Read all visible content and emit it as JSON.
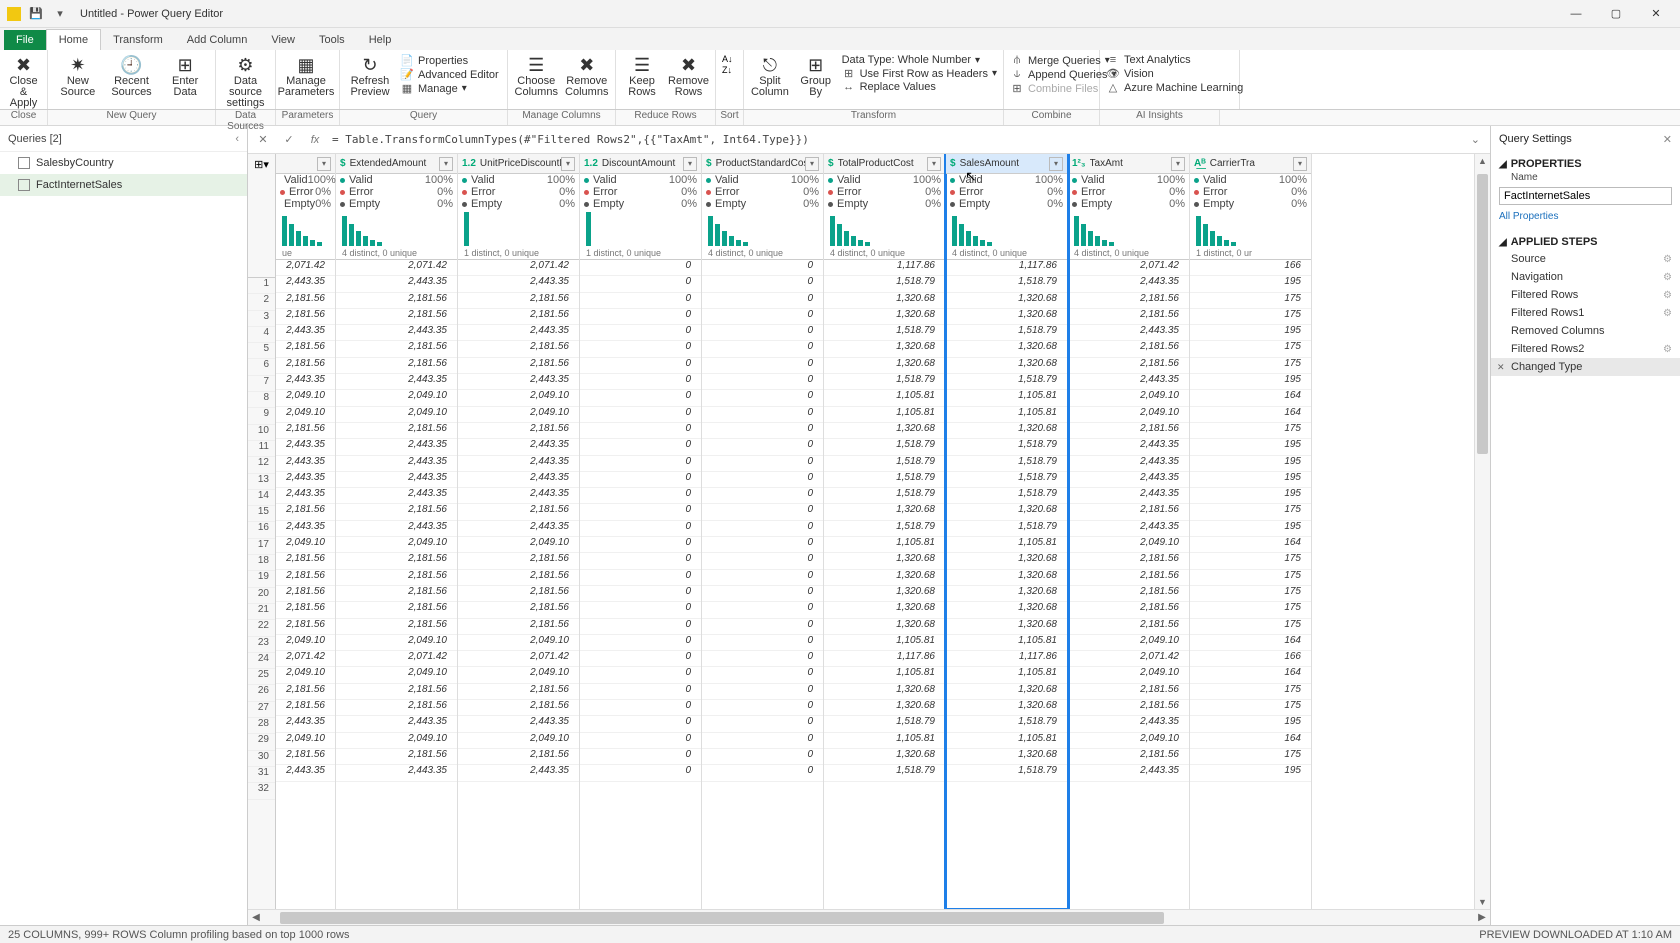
{
  "title": "Untitled - Power Query Editor",
  "menu_tabs": [
    "File",
    "Home",
    "Transform",
    "Add Column",
    "View",
    "Tools",
    "Help"
  ],
  "ribbon": {
    "close_apply": "Close & Apply",
    "new_source": "New Source",
    "recent_sources": "Recent Sources",
    "enter_data": "Enter Data",
    "data_source": "Data source settings",
    "manage_params": "Manage Parameters",
    "refresh": "Refresh Preview",
    "properties": "Properties",
    "adv_editor": "Advanced Editor",
    "manage": "Manage",
    "choose_cols": "Choose Columns",
    "remove_cols": "Remove Columns",
    "keep_rows": "Keep Rows",
    "remove_rows": "Remove Rows",
    "sort": "Sort",
    "split_col": "Split Column",
    "group_by": "Group By",
    "data_type": "Data Type: Whole Number",
    "first_row": "Use First Row as Headers",
    "replace": "Replace Values",
    "merge": "Merge Queries",
    "append": "Append Queries",
    "combine_files": "Combine Files",
    "text_an": "Text Analytics",
    "vision": "Vision",
    "azure_ml": "Azure Machine Learning"
  },
  "ribbon_labels": [
    "Close",
    "New Query",
    "Data Sources",
    "Parameters",
    "Query",
    "Manage Columns",
    "Reduce Rows",
    "Sort",
    "Transform",
    "Combine",
    "AI Insights"
  ],
  "ribbon_widths": [
    48,
    168,
    60,
    64,
    168,
    108,
    100,
    28,
    260,
    96,
    120
  ],
  "queries_header": "Queries [2]",
  "queries": [
    "SalesbyCountry",
    "FactInternetSales"
  ],
  "formula": "= Table.TransformColumnTypes(#\"Filtered Rows2\",{{\"TaxAmt\", Int64.Type}})",
  "columns": [
    {
      "name": "",
      "type": "",
      "first": true,
      "distinct": "ue"
    },
    {
      "name": "ExtendedAmount",
      "type": "$",
      "distinct": "4 distinct, 0 unique"
    },
    {
      "name": "UnitPriceDiscountPct",
      "type": "1.2",
      "distinct": "1 distinct, 0 unique"
    },
    {
      "name": "DiscountAmount",
      "type": "1.2",
      "distinct": "1 distinct, 0 unique"
    },
    {
      "name": "ProductStandardCost",
      "type": "$",
      "distinct": "4 distinct, 0 unique"
    },
    {
      "name": "TotalProductCost",
      "type": "$",
      "distinct": "4 distinct, 0 unique"
    },
    {
      "name": "SalesAmount",
      "type": "$",
      "distinct": "4 distinct, 0 unique",
      "hl": true
    },
    {
      "name": "TaxAmt",
      "type": "1²₃",
      "distinct": "4 distinct, 0 unique"
    },
    {
      "name": "CarrierTra",
      "type": "A͟ᴮ",
      "distinct": "1 distinct, 0 ur"
    }
  ],
  "quality": [
    "Valid",
    "Error",
    "Empty"
  ],
  "quality_pct": [
    "100%",
    "0%",
    "0%"
  ],
  "settings": {
    "title": "Query Settings",
    "props": "PROPERTIES",
    "name_lbl": "Name",
    "name_val": "FactInternetSales",
    "all_props": "All Properties",
    "steps_title": "APPLIED STEPS",
    "steps": [
      "Source",
      "Navigation",
      "Filtered Rows",
      "Filtered Rows1",
      "Removed Columns",
      "Filtered Rows2",
      "Changed Type"
    ]
  },
  "status_left": "25 COLUMNS, 999+ ROWS    Column profiling based on top 1000 rows",
  "status_right": "PREVIEW DOWNLOADED AT 1:10 AM",
  "chart_data": {
    "type": "table",
    "rows": [
      [
        "2,071.42",
        "2,071.42",
        "0",
        "0",
        "1,117.86",
        "1,117.86",
        "2,071.42",
        "166"
      ],
      [
        "2,443.35",
        "2,443.35",
        "0",
        "0",
        "1,518.79",
        "1,518.79",
        "2,443.35",
        "195"
      ],
      [
        "2,181.56",
        "2,181.56",
        "0",
        "0",
        "1,320.68",
        "1,320.68",
        "2,181.56",
        "175"
      ],
      [
        "2,181.56",
        "2,181.56",
        "0",
        "0",
        "1,320.68",
        "1,320.68",
        "2,181.56",
        "175"
      ],
      [
        "2,443.35",
        "2,443.35",
        "0",
        "0",
        "1,518.79",
        "1,518.79",
        "2,443.35",
        "195"
      ],
      [
        "2,181.56",
        "2,181.56",
        "0",
        "0",
        "1,320.68",
        "1,320.68",
        "2,181.56",
        "175"
      ],
      [
        "2,181.56",
        "2,181.56",
        "0",
        "0",
        "1,320.68",
        "1,320.68",
        "2,181.56",
        "175"
      ],
      [
        "2,443.35",
        "2,443.35",
        "0",
        "0",
        "1,518.79",
        "1,518.79",
        "2,443.35",
        "195"
      ],
      [
        "2,049.10",
        "2,049.10",
        "0",
        "0",
        "1,105.81",
        "1,105.81",
        "2,049.10",
        "164"
      ],
      [
        "2,049.10",
        "2,049.10",
        "0",
        "0",
        "1,105.81",
        "1,105.81",
        "2,049.10",
        "164"
      ],
      [
        "2,181.56",
        "2,181.56",
        "0",
        "0",
        "1,320.68",
        "1,320.68",
        "2,181.56",
        "175"
      ],
      [
        "2,443.35",
        "2,443.35",
        "0",
        "0",
        "1,518.79",
        "1,518.79",
        "2,443.35",
        "195"
      ],
      [
        "2,443.35",
        "2,443.35",
        "0",
        "0",
        "1,518.79",
        "1,518.79",
        "2,443.35",
        "195"
      ],
      [
        "2,443.35",
        "2,443.35",
        "0",
        "0",
        "1,518.79",
        "1,518.79",
        "2,443.35",
        "195"
      ],
      [
        "2,443.35",
        "2,443.35",
        "0",
        "0",
        "1,518.79",
        "1,518.79",
        "2,443.35",
        "195"
      ],
      [
        "2,181.56",
        "2,181.56",
        "0",
        "0",
        "1,320.68",
        "1,320.68",
        "2,181.56",
        "175"
      ],
      [
        "2,443.35",
        "2,443.35",
        "0",
        "0",
        "1,518.79",
        "1,518.79",
        "2,443.35",
        "195"
      ],
      [
        "2,049.10",
        "2,049.10",
        "0",
        "0",
        "1,105.81",
        "1,105.81",
        "2,049.10",
        "164"
      ],
      [
        "2,181.56",
        "2,181.56",
        "0",
        "0",
        "1,320.68",
        "1,320.68",
        "2,181.56",
        "175"
      ],
      [
        "2,181.56",
        "2,181.56",
        "0",
        "0",
        "1,320.68",
        "1,320.68",
        "2,181.56",
        "175"
      ],
      [
        "2,181.56",
        "2,181.56",
        "0",
        "0",
        "1,320.68",
        "1,320.68",
        "2,181.56",
        "175"
      ],
      [
        "2,181.56",
        "2,181.56",
        "0",
        "0",
        "1,320.68",
        "1,320.68",
        "2,181.56",
        "175"
      ],
      [
        "2,181.56",
        "2,181.56",
        "0",
        "0",
        "1,320.68",
        "1,320.68",
        "2,181.56",
        "175"
      ],
      [
        "2,049.10",
        "2,049.10",
        "0",
        "0",
        "1,105.81",
        "1,105.81",
        "2,049.10",
        "164"
      ],
      [
        "2,071.42",
        "2,071.42",
        "0",
        "0",
        "1,117.86",
        "1,117.86",
        "2,071.42",
        "166"
      ],
      [
        "2,049.10",
        "2,049.10",
        "0",
        "0",
        "1,105.81",
        "1,105.81",
        "2,049.10",
        "164"
      ],
      [
        "2,181.56",
        "2,181.56",
        "0",
        "0",
        "1,320.68",
        "1,320.68",
        "2,181.56",
        "175"
      ],
      [
        "2,181.56",
        "2,181.56",
        "0",
        "0",
        "1,320.68",
        "1,320.68",
        "2,181.56",
        "175"
      ],
      [
        "2,443.35",
        "2,443.35",
        "0",
        "0",
        "1,518.79",
        "1,518.79",
        "2,443.35",
        "195"
      ],
      [
        "2,049.10",
        "2,049.10",
        "0",
        "0",
        "1,105.81",
        "1,105.81",
        "2,049.10",
        "164"
      ],
      [
        "2,181.56",
        "2,181.56",
        "0",
        "0",
        "1,320.68",
        "1,320.68",
        "2,181.56",
        "175"
      ],
      [
        "2,443.35",
        "2,443.35",
        "0",
        "0",
        "1,518.79",
        "1,518.79",
        "2,443.35",
        "195"
      ]
    ],
    "profile_bars": [
      30,
      22,
      15,
      10,
      6,
      4
    ],
    "profile_single": [
      34
    ]
  }
}
